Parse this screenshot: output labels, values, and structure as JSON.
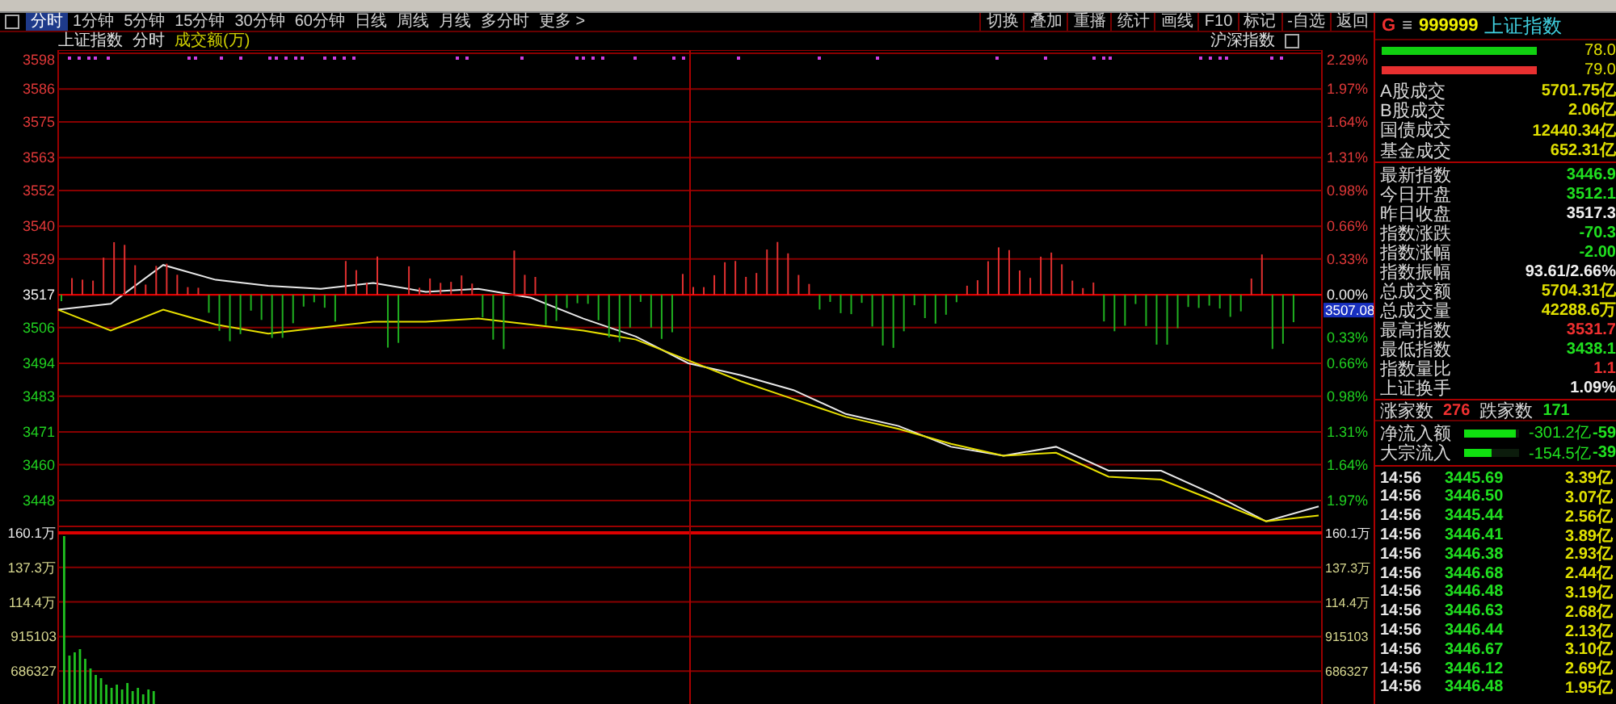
{
  "toolbar": {
    "tabs": [
      {
        "label": "分时",
        "selected": true
      },
      {
        "label": "1分钟",
        "selected": false
      },
      {
        "label": "5分钟",
        "selected": false
      },
      {
        "label": "15分钟",
        "selected": false
      },
      {
        "label": "30分钟",
        "selected": false
      },
      {
        "label": "60分钟",
        "selected": false
      },
      {
        "label": "日线",
        "selected": false
      },
      {
        "label": "周线",
        "selected": false
      },
      {
        "label": "月线",
        "selected": false
      },
      {
        "label": "多分时",
        "selected": false
      },
      {
        "label": "更多 >",
        "selected": false
      }
    ],
    "tools": [
      "切换",
      "叠加",
      "重播",
      "统计",
      "画线",
      "F10",
      "标记",
      "-自选",
      "返回"
    ]
  },
  "chart_header": {
    "title": "上证指数",
    "mode": "分时",
    "indicator": "成交额(万)",
    "market": "沪深指数"
  },
  "price_chart": {
    "chart_data": {
      "type": "line",
      "ylim": [
        3439.3,
        3599.1
      ],
      "grid": true,
      "yticks": [
        {
          "value": 3598,
          "label": "3598"
        },
        {
          "value": 3586,
          "label": "3586"
        },
        {
          "value": 3575,
          "label": "3575"
        },
        {
          "value": 3563,
          "label": "3563"
        },
        {
          "value": 3552,
          "label": "3552"
        },
        {
          "value": 3540,
          "label": "3540"
        },
        {
          "value": 3529,
          "label": "3529"
        },
        {
          "value": 3517,
          "label": "3517"
        },
        {
          "value": 3506,
          "label": "3506"
        },
        {
          "value": 3494,
          "label": "3494"
        },
        {
          "value": 3483,
          "label": "3483"
        },
        {
          "value": 3471,
          "label": "3471"
        },
        {
          "value": 3460,
          "label": "3460"
        },
        {
          "value": 3448,
          "label": "3448"
        }
      ],
      "series": [
        {
          "color": "#e8e8e8",
          "values": [
            3512,
            3514,
            3527,
            3522,
            3520,
            3519,
            3521,
            3518,
            3519,
            3516,
            3509,
            3503,
            3494,
            3490,
            3485,
            3477,
            3473,
            3466,
            3463,
            3466,
            3458,
            3458,
            3450,
            3441,
            3446
          ]
        },
        {
          "color": "#e8e000",
          "values": [
            3512,
            3505,
            3512,
            3507,
            3504,
            3506,
            3508,
            3508,
            3509,
            3507,
            3505,
            3502,
            3495,
            3488,
            3482,
            3476,
            3472,
            3467,
            3463,
            3464,
            3456,
            3455,
            3448,
            3441,
            3443
          ]
        }
      ]
    },
    "percent_labels": [
      {
        "text": "2.29%",
        "kind": "up"
      },
      {
        "text": "1.97%",
        "kind": "up"
      },
      {
        "text": "1.64%",
        "kind": "up"
      },
      {
        "text": "1.31%",
        "kind": "up"
      },
      {
        "text": "0.98%",
        "kind": "up"
      },
      {
        "text": "0.66%",
        "kind": "up"
      },
      {
        "text": "0.33%",
        "kind": "up"
      },
      {
        "text": "0.00%",
        "kind": "flat"
      },
      {
        "text": "0.33%",
        "kind": "down"
      },
      {
        "text": "0.66%",
        "kind": "down"
      },
      {
        "text": "0.98%",
        "kind": "down"
      },
      {
        "text": "1.31%",
        "kind": "down"
      },
      {
        "text": "1.64%",
        "kind": "down"
      },
      {
        "text": "1.97%",
        "kind": "down"
      }
    ],
    "cursor_label": "3507.08"
  },
  "volume_chart": {
    "left_labels": [
      "160.1万",
      "137.3万",
      "114.4万",
      "915103",
      "686327"
    ],
    "right_labels": [
      "160.1万",
      "137.3万",
      "114.4万",
      "915103",
      "686327"
    ]
  },
  "quote": {
    "flag": "G",
    "menu_glyph": "≡",
    "code": "999999",
    "name": "上证指数"
  },
  "ratio_bars": [
    {
      "level": 0.96,
      "color": "#10d010",
      "value": "78.0"
    },
    {
      "level": 0.96,
      "color": "#e83030",
      "value": "79.0"
    }
  ],
  "turnover_rows": [
    {
      "label": "A股成交",
      "value": "5701.75亿",
      "color": "#e0e000"
    },
    {
      "label": "B股成交",
      "value": "2.06亿",
      "color": "#e0e000"
    },
    {
      "label": "国债成交",
      "value": "12440.34亿",
      "color": "#e0e000"
    },
    {
      "label": "基金成交",
      "value": "652.31亿",
      "color": "#e0e000"
    }
  ],
  "index_rows": [
    {
      "label": "最新指数",
      "value": "3446.9",
      "color": "#20e020"
    },
    {
      "label": "今日开盘",
      "value": "3512.1",
      "color": "#20e020"
    },
    {
      "label": "昨日收盘",
      "value": "3517.3",
      "color": "#f0f0f0"
    },
    {
      "label": "指数涨跌",
      "value": "-70.3",
      "color": "#20e020"
    },
    {
      "label": "指数涨幅",
      "value": "-2.00",
      "color": "#20e020"
    },
    {
      "label": "指数振幅",
      "value": "93.61/2.66%",
      "color": "#f0f0f0"
    },
    {
      "label": "总成交额",
      "value": "5704.31亿",
      "color": "#e0e000"
    },
    {
      "label": "总成交量",
      "value": "42288.6万",
      "color": "#e0e000"
    },
    {
      "label": "最高指数",
      "value": "3531.7",
      "color": "#f03030"
    },
    {
      "label": "最低指数",
      "value": "3438.1",
      "color": "#20e020"
    },
    {
      "label": "指数量比",
      "value": "1.1",
      "color": "#f03030"
    },
    {
      "label": "上证换手",
      "value": "1.09%",
      "color": "#f0f0f0"
    }
  ],
  "breadth": {
    "up_label": "涨家数",
    "up_count": "276",
    "down_label": "跌家数",
    "down_count": "171"
  },
  "flows": [
    {
      "label": "净流入额",
      "level": 0.95,
      "value": "-301.2亿",
      "extra": "-59"
    },
    {
      "label": "大宗流入",
      "level": 0.5,
      "value": "-154.5亿",
      "extra": "-39"
    }
  ],
  "ticks": [
    {
      "time": "14:56",
      "price": "3445.69",
      "volume": "3.39亿"
    },
    {
      "time": "14:56",
      "price": "3446.50",
      "volume": "3.07亿"
    },
    {
      "time": "14:56",
      "price": "3445.44",
      "volume": "2.56亿"
    },
    {
      "time": "14:56",
      "price": "3446.41",
      "volume": "3.89亿"
    },
    {
      "time": "14:56",
      "price": "3446.38",
      "volume": "2.93亿"
    },
    {
      "time": "14:56",
      "price": "3446.68",
      "volume": "2.44亿"
    },
    {
      "time": "14:56",
      "price": "3446.48",
      "volume": "3.19亿"
    },
    {
      "time": "14:56",
      "price": "3446.63",
      "volume": "2.68亿"
    },
    {
      "time": "14:56",
      "price": "3446.44",
      "volume": "2.13亿"
    },
    {
      "time": "14:56",
      "price": "3446.67",
      "volume": "3.10亿"
    },
    {
      "time": "14:56",
      "price": "3446.12",
      "volume": "2.69亿"
    },
    {
      "time": "14:56",
      "price": "3446.48",
      "volume": "1.95亿"
    }
  ]
}
